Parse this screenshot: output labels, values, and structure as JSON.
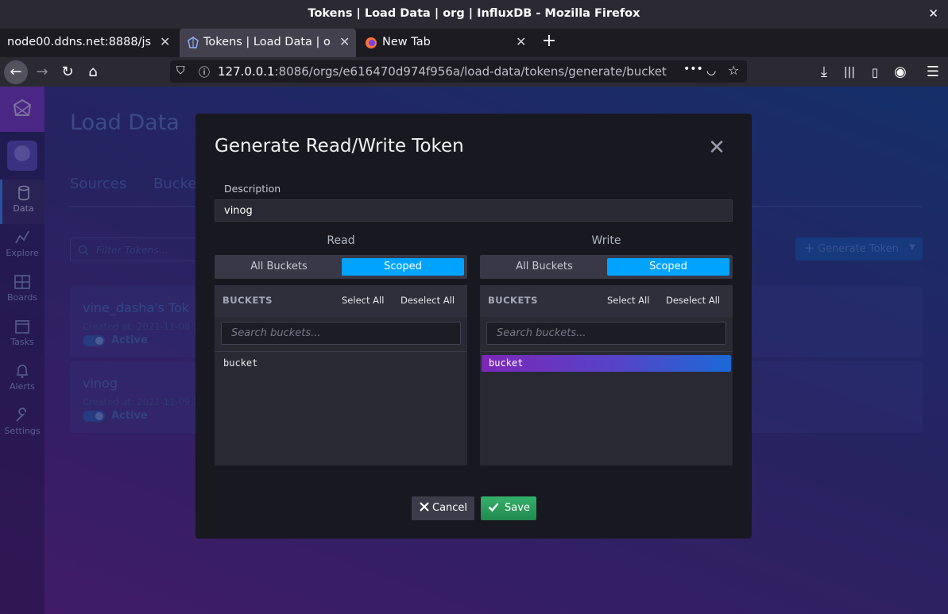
{
  "window": {
    "title": "Tokens | Load Data | org | InfluxDB - Mozilla Firefox"
  },
  "browser": {
    "tabs": [
      {
        "label": "node00.ddns.net:8888/js"
      },
      {
        "label": "Tokens | Load Data | o"
      },
      {
        "label": "New Tab"
      }
    ],
    "url_host": "127.0.0.1",
    "url_rest": ":8086/orgs/e616470d974f956a/load-data/tokens/generate/bucket"
  },
  "sidebar": {
    "items": [
      {
        "label": "Data"
      },
      {
        "label": "Explore"
      },
      {
        "label": "Boards"
      },
      {
        "label": "Tasks"
      },
      {
        "label": "Alerts"
      },
      {
        "label": "Settings"
      }
    ]
  },
  "page": {
    "title": "Load Data",
    "tabs": [
      "Sources",
      "Bucke"
    ],
    "filter_placeholder": "Filter Tokens...",
    "generate_button": "Generate Token",
    "tokens": [
      {
        "name": "vine_dasha's Tok",
        "created": "Created at: 2021-11-08 1",
        "status": "Active"
      },
      {
        "name": "vinog",
        "created": "Created at: 2021-11-09 1",
        "status": "Active"
      }
    ]
  },
  "modal": {
    "title": "Generate Read/Write Token",
    "description_label": "Description",
    "description_value": "vinog",
    "read": {
      "heading": "Read",
      "all_label": "All Buckets",
      "scoped_label": "Scoped",
      "selected": "Scoped",
      "panel_title": "BUCKETS",
      "select_all": "Select All",
      "deselect_all": "Deselect All",
      "search_placeholder": "Search buckets...",
      "buckets": [
        {
          "name": "bucket",
          "selected": false
        }
      ]
    },
    "write": {
      "heading": "Write",
      "all_label": "All Buckets",
      "scoped_label": "Scoped",
      "selected": "Scoped",
      "panel_title": "BUCKETS",
      "select_all": "Select All",
      "deselect_all": "Deselect All",
      "search_placeholder": "Search buckets...",
      "buckets": [
        {
          "name": "bucket",
          "selected": true
        }
      ]
    },
    "cancel_label": "Cancel",
    "save_label": "Save"
  },
  "colors": {
    "accent": "#00a3ff",
    "save": "#2d9c5d",
    "modal_bg": "#181820"
  }
}
